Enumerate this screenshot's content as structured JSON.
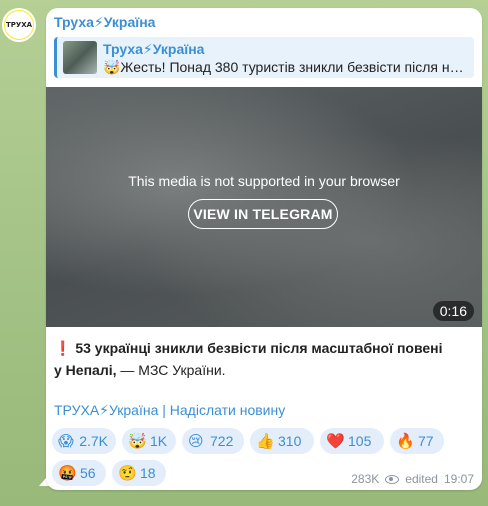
{
  "avatar": {
    "text": "ТРУХА"
  },
  "message": {
    "sender": "Труха⚡Україна",
    "reply": {
      "title": "Труха⚡Україна",
      "text": "🤯Жесть! Понад 380 туристів зникли безвісти після н…"
    },
    "media": {
      "notice": "This media is not supported in your browser",
      "button": "VIEW IN TELEGRAM",
      "duration": "0:16"
    },
    "body": {
      "icon": "❗",
      "bold": "53 українці зникли безвісти після масштабної повені у Непалі,",
      "rest": " — МЗС України."
    },
    "footer_link": "ТРУХА⚡Україна | Надіслати новину",
    "reactions": [
      {
        "emoji": "😱",
        "count": "2.7K"
      },
      {
        "emoji": "🤯",
        "count": "1K"
      },
      {
        "emoji": "😢",
        "count": "722"
      },
      {
        "emoji": "👍",
        "count": "310"
      },
      {
        "emoji": "❤️",
        "count": "105"
      },
      {
        "emoji": "🔥",
        "count": "77"
      },
      {
        "emoji": "🤬",
        "count": "56"
      },
      {
        "emoji": "🤨",
        "count": "18"
      }
    ],
    "views": "283K",
    "edited": "edited",
    "time": "19:07"
  }
}
